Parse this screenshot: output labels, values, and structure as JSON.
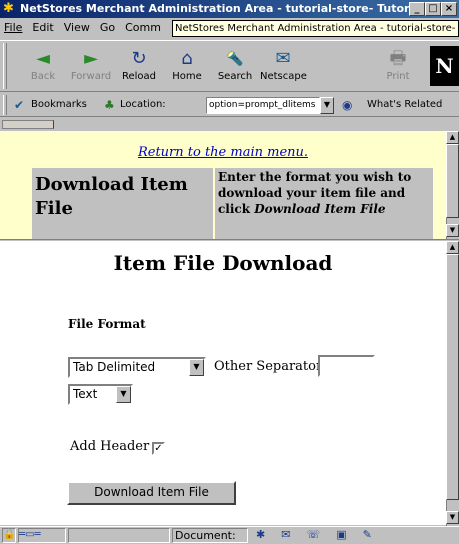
{
  "window": {
    "title": "NetStores Merchant Administration Area - tutorial-store- Tutori..."
  },
  "menu": {
    "items": [
      "File",
      "Edit",
      "View",
      "Go",
      "Comm"
    ],
    "tooltip": "NetStores Merchant Administration Area - tutorial-store- Tutorial"
  },
  "toolbar": {
    "buttons": [
      {
        "label": "Back",
        "icon": "back-arrow-icon",
        "glyph": "◄",
        "enabled": false
      },
      {
        "label": "Forward",
        "icon": "forward-arrow-icon",
        "glyph": "►",
        "enabled": false
      },
      {
        "label": "Reload",
        "icon": "reload-icon",
        "glyph": "↻",
        "enabled": true
      },
      {
        "label": "Home",
        "icon": "home-icon",
        "glyph": "⌂",
        "enabled": true
      },
      {
        "label": "Search",
        "icon": "search-icon",
        "glyph": "🔦",
        "enabled": true
      },
      {
        "label": "Netscape",
        "icon": "netscape-icon",
        "glyph": "✉",
        "enabled": true
      },
      {
        "label": "Print",
        "icon": "print-icon",
        "glyph": "🖶",
        "enabled": false
      }
    ],
    "logo": "N"
  },
  "location": {
    "bookmarks_label": "Bookmarks",
    "location_label": "Location:",
    "url": "option=prompt_dlitems",
    "related_label": "What's Related"
  },
  "top_frame": {
    "return_link": "Return to the main menu.",
    "title": "Download Item File",
    "instruction_part1": "Enter the format you wish to download your item file and click ",
    "instruction_em": "Download Item File"
  },
  "main_frame": {
    "heading": "Item File Download",
    "file_format_label": "File Format",
    "format_select_value": "Tab Delimited",
    "other_separator_label": "Other Separator",
    "other_separator_value": "",
    "type_select_value": "Text",
    "add_header_label": "Add Header",
    "add_header_checked": true,
    "download_button_label": "Download Item File"
  },
  "status": {
    "text": "Document: Done"
  }
}
